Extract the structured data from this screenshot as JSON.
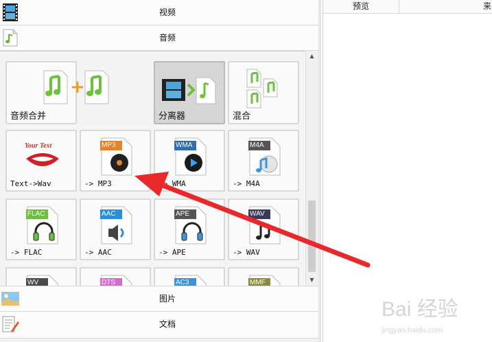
{
  "categories": {
    "video": {
      "label": "视频",
      "icon": "film-strip-icon"
    },
    "audio": {
      "label": "音频",
      "icon": "music-note-document-icon"
    },
    "image": {
      "label": "图片",
      "icon": "landscape-photo-icon"
    },
    "document": {
      "label": "文档",
      "icon": "document-pencil-icon"
    }
  },
  "tools": [
    {
      "label": "音频合并",
      "icon": "music-plus-music-icon"
    },
    {
      "label": "分离器",
      "icon": "film-to-audio-icon",
      "selected": true
    },
    {
      "label": "混合",
      "icon": "music-mix-icon"
    }
  ],
  "formats": [
    {
      "label": "Text->Wav",
      "badge": "Your Text",
      "icon": "lips-speech-icon"
    },
    {
      "label": "-> MP3",
      "badge": "MP3",
      "badge_color": "#e8822a",
      "icon": "vinyl-record-icon"
    },
    {
      "label": "-> WMA",
      "badge": "WMA",
      "badge_color": "#2f6fb0",
      "icon": "disc-play-icon"
    },
    {
      "label": "-> M4A",
      "badge": "M4A",
      "badge_color": "#555555",
      "icon": "music-cd-icon"
    },
    {
      "label": "-> FLAC",
      "badge": "FLAC",
      "badge_color": "#6dbf3f",
      "icon": "headphones-icon"
    },
    {
      "label": "-> AAC",
      "badge": "AAC",
      "badge_color": "#2a8fd6",
      "icon": "speaker-icon"
    },
    {
      "label": "-> APE",
      "badge": "APE",
      "badge_color": "#555555",
      "icon": "headphones-icon"
    },
    {
      "label": "-> WAV",
      "badge": "WAV",
      "badge_color": "#3a3a5a",
      "icon": "music-notes-icon"
    },
    {
      "label": "",
      "badge": "WV",
      "badge_color": "#4a4a4a",
      "icon": "file-icon"
    },
    {
      "label": "",
      "badge": "DTS",
      "badge_color": "#d46bd0",
      "icon": "file-icon"
    },
    {
      "label": "",
      "badge": "AC3",
      "badge_color": "#3d8fe0",
      "icon": "file-icon"
    },
    {
      "label": "",
      "badge": "MMF",
      "badge_color": "#8a8a3a",
      "icon": "file-icon"
    }
  ],
  "right_panel": {
    "col_preview": "预览",
    "col_source": "来"
  },
  "watermark": {
    "brand": "Bai 经验",
    "url": "jingyan.baidu.com"
  },
  "colors": {
    "arrow": "#e8282a",
    "note_green": "#6dc23c"
  }
}
